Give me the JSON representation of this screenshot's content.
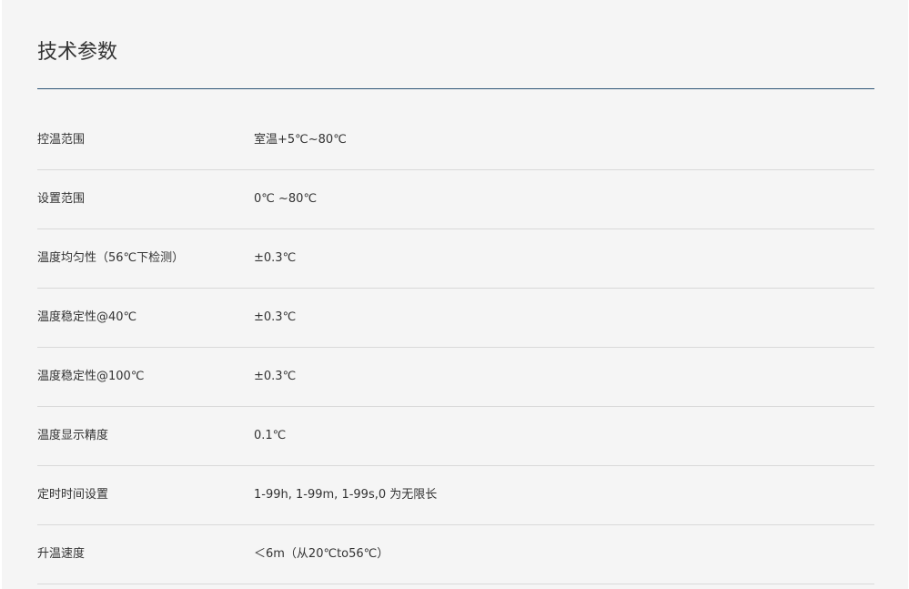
{
  "section": {
    "title": "技术参数"
  },
  "specs": [
    {
      "name": "控温范围",
      "value": "室温+5℃~80℃"
    },
    {
      "name": "设置范围",
      "value": "0℃ ~80℃"
    },
    {
      "name": "温度均匀性（56℃下检测）",
      "value": "±0.3℃"
    },
    {
      "name": "温度稳定性@40℃",
      "value": "±0.3℃"
    },
    {
      "name": "温度稳定性@100℃",
      "value": "±0.3℃"
    },
    {
      "name": "温度显示精度",
      "value": "0.1℃"
    },
    {
      "name": "定时时间设置",
      "value": "1-99h, 1-99m, 1-99s,0 为无限长"
    },
    {
      "name": "升温速度",
      "value": "＜6m（从20℃to56℃）"
    }
  ],
  "colors": {
    "panel_background": "#f5f5f5",
    "title_rule": "#2f5577",
    "row_divider": "#d9d9d9",
    "text": "#333333"
  }
}
